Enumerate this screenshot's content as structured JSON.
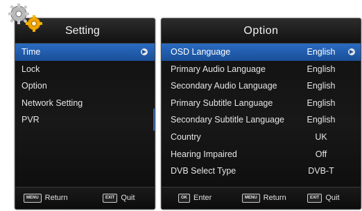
{
  "setting_panel": {
    "title": "Setting",
    "items": [
      {
        "label": "Time"
      },
      {
        "label": "Lock"
      },
      {
        "label": "Option"
      },
      {
        "label": "Network Setting"
      },
      {
        "label": "PVR"
      }
    ],
    "selected_index": 0,
    "footer": {
      "menu_key": "MENU",
      "menu_label": "Return",
      "exit_key": "EXIT",
      "exit_label": "Quit"
    }
  },
  "option_panel": {
    "title": "Option",
    "rows": [
      {
        "label": "OSD Language",
        "value": "English"
      },
      {
        "label": "Primary Audio Language",
        "value": "English"
      },
      {
        "label": "Secondary Audio Language",
        "value": "English"
      },
      {
        "label": "Primary Subtitle Language",
        "value": "English"
      },
      {
        "label": "Secondary Subtitle Language",
        "value": "English"
      },
      {
        "label": "Country",
        "value": "UK"
      },
      {
        "label": "Hearing Impaired",
        "value": "Off"
      },
      {
        "label": "DVB Select Type",
        "value": "DVB-T"
      }
    ],
    "selected_index": 0,
    "footer": {
      "ok_key": "OK",
      "ok_label": "Enter",
      "menu_key": "MENU",
      "menu_label": "Return",
      "exit_key": "EXIT",
      "exit_label": "Quit"
    }
  },
  "icons": {
    "settings": "gears-icon",
    "arrow": "arrow-right-circle-icon"
  },
  "colors": {
    "highlight": "#2a6bc2",
    "panel_bg": "#141414",
    "text": "#e6e6e6"
  }
}
